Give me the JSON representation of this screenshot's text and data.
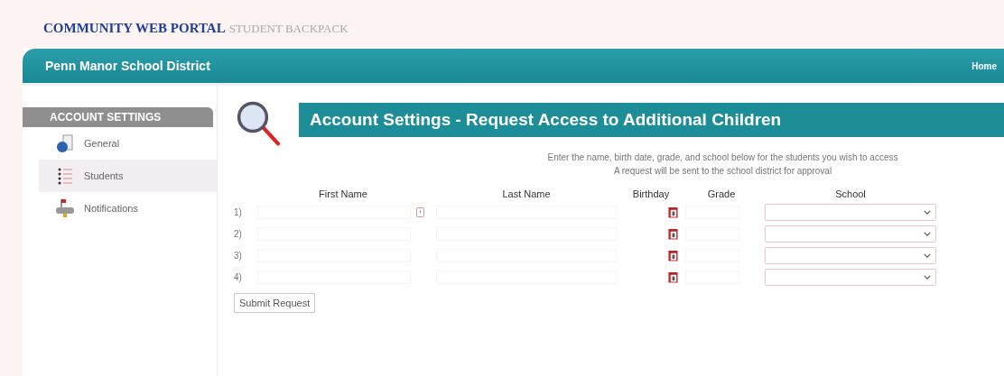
{
  "header": {
    "brand": "COMMUNITY WEB PORTAL",
    "product": "STUDENT BACKPACK"
  },
  "nav_bar": {
    "district": "Penn Manor School District",
    "home_link": "Home"
  },
  "sidebar": {
    "title": "ACCOUNT SETTINGS",
    "items": [
      {
        "label": "General",
        "kind": "general",
        "selected": false
      },
      {
        "label": "Students",
        "kind": "students",
        "selected": true
      },
      {
        "label": "Notifications",
        "kind": "notifications",
        "selected": false
      }
    ]
  },
  "page_title": "Account Settings - Request Access to Additional Children",
  "instructions": [
    "Enter the name, birth date, grade, and school below for the students you wish to access",
    "A request will be sent to the school district for approval"
  ],
  "form": {
    "columns": [
      "First Name",
      "Last Name",
      "Birthday",
      "Grade",
      "School"
    ],
    "rows": [
      {
        "number": "1)",
        "hint_icon": true
      },
      {
        "number": "2)",
        "hint_icon": false
      },
      {
        "number": "3)",
        "hint_icon": false
      },
      {
        "number": "4)",
        "hint_icon": false
      }
    ],
    "submit": "Submit Request"
  }
}
